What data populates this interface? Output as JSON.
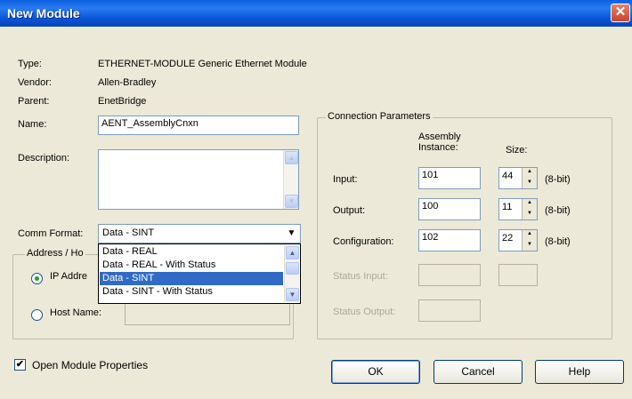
{
  "window": {
    "title": "New Module",
    "close_glyph": "✕"
  },
  "info": {
    "type_label": "Type:",
    "type_value": "ETHERNET-MODULE Generic Ethernet Module",
    "vendor_label": "Vendor:",
    "vendor_value": "Allen-Bradley",
    "parent_label": "Parent:",
    "parent_value": "EnetBridge"
  },
  "name": {
    "label": "Name:",
    "value": "AENT_AssemblyCnxn"
  },
  "description": {
    "label": "Description:",
    "value": ""
  },
  "comm_format": {
    "label": "Comm Format:",
    "selected": "Data - SINT",
    "options": [
      "Data - REAL",
      "Data - REAL - With Status",
      "Data - SINT",
      "Data - SINT - With Status"
    ],
    "selected_index": 2
  },
  "address_group": {
    "title": "Address / Ho",
    "ip_label": "IP Addre",
    "host_label": "Host Name:",
    "host_value": ""
  },
  "connection": {
    "title": "Connection Parameters",
    "col_instance": "Assembly Instance:",
    "col_size": "Size:",
    "rows": [
      {
        "label": "Input:",
        "instance": "101",
        "size": "44",
        "unit": "(8-bit)",
        "enabled": true
      },
      {
        "label": "Output:",
        "instance": "100",
        "size": "11",
        "unit": "(8-bit)",
        "enabled": true
      },
      {
        "label": "Configuration:",
        "instance": "102",
        "size": "22",
        "unit": "(8-bit)",
        "enabled": true
      },
      {
        "label": "Status Input:",
        "instance": "",
        "size": "",
        "unit": "",
        "enabled": false
      },
      {
        "label": "Status Output:",
        "instance": "",
        "size": "",
        "unit": "",
        "enabled": false
      }
    ]
  },
  "open_props": {
    "label": "Open Module Properties",
    "checked": true
  },
  "buttons": {
    "ok": "OK",
    "cancel": "Cancel",
    "help": "Help"
  },
  "icons": {
    "checkmark": "check-icon",
    "close": "close-icon",
    "dropdown": "chevron-down-icon"
  }
}
